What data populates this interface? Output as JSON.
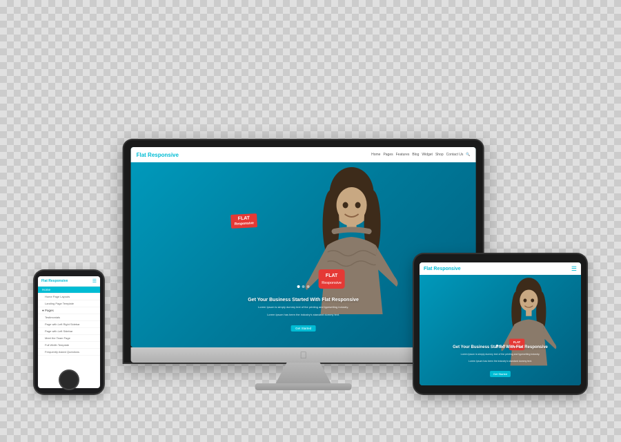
{
  "scene": {
    "background": "checkerboard"
  },
  "website": {
    "logo_plain": "Flat ",
    "logo_colored": "Responsive",
    "nav_links": [
      "Home",
      "Pages",
      "Features",
      "Blog",
      "Widget",
      "Shop",
      "Contact Us"
    ],
    "hero_title": "Get Your Business Started With Flat Responsive",
    "hero_subtitle_line1": "Lorem Ipsum is simply dummy text of the printing and typesetting industry.",
    "hero_subtitle_line2": "Lorem Ipsum has been the industry's standard dummy text.",
    "cta_button": "Get Started",
    "flat_badge_line1": "FLAT",
    "flat_badge_line2": "Responsive"
  },
  "phone_menu": {
    "items": [
      {
        "label": "Home",
        "active": true,
        "sub": false
      },
      {
        "label": "Home Page Layouts",
        "active": false,
        "sub": true
      },
      {
        "label": "Landing Page Template",
        "active": false,
        "sub": true
      },
      {
        "label": "Pages",
        "active": false,
        "sub": false
      },
      {
        "label": "Testimonials",
        "active": false,
        "sub": true
      },
      {
        "label": "Page with Left Right Sidebar",
        "active": false,
        "sub": true
      },
      {
        "label": "Page with Left Sidebar",
        "active": false,
        "sub": true
      },
      {
        "label": "Meet the Team Page",
        "active": false,
        "sub": true
      },
      {
        "label": "Full Width Template",
        "active": false,
        "sub": true
      },
      {
        "label": "Frequently Asked Questions",
        "active": false,
        "sub": true
      }
    ]
  }
}
